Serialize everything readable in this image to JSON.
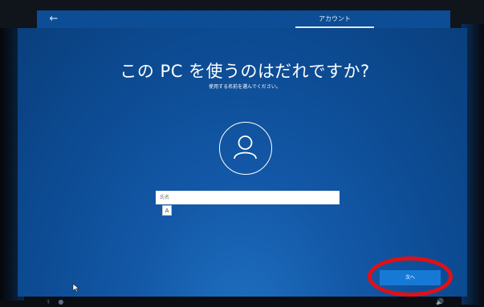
{
  "header": {
    "back_icon": "arrow-left-icon",
    "tab_label": "アカウント"
  },
  "main": {
    "title": "この PC を使うのはだれですか?",
    "subtitle": "使用する名前を選んでください。",
    "avatar_icon": "user-icon",
    "name_input": {
      "placeholder": "氏名",
      "value": ""
    },
    "ime_indicator": "A"
  },
  "footer": {
    "next_label": "次へ",
    "accessibility_icon": "ease-of-access-icon",
    "mic_icon": "microphone-icon",
    "volume_icon": "volume-icon"
  },
  "colors": {
    "background": "#0c4a91",
    "button": "#1679d6",
    "highlight": "#e11017"
  }
}
